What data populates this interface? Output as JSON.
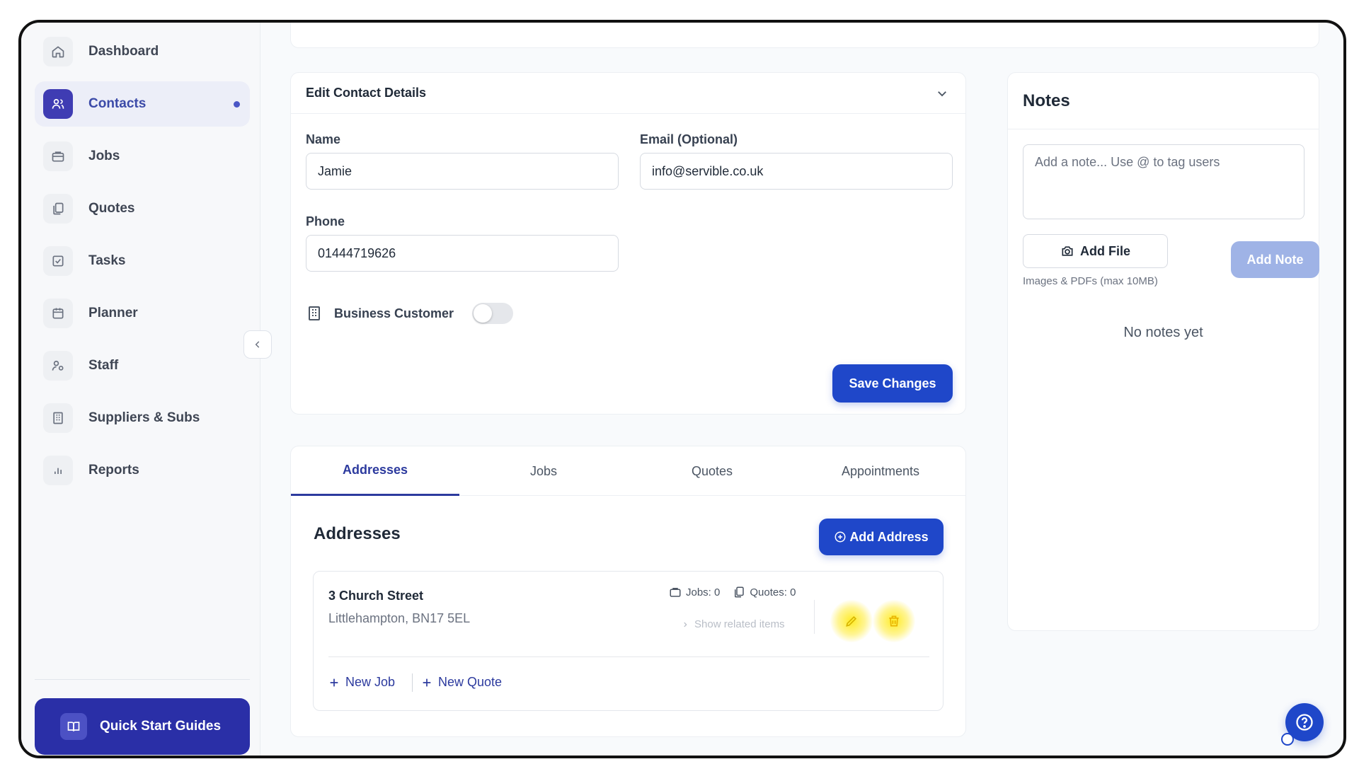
{
  "sidebar": {
    "items": [
      {
        "label": "Dashboard",
        "icon": "home-icon"
      },
      {
        "label": "Contacts",
        "icon": "users-icon",
        "active": true
      },
      {
        "label": "Jobs",
        "icon": "briefcase-icon"
      },
      {
        "label": "Quotes",
        "icon": "documents-icon"
      },
      {
        "label": "Tasks",
        "icon": "checkbox-icon"
      },
      {
        "label": "Planner",
        "icon": "calendar-icon"
      },
      {
        "label": "Staff",
        "icon": "staff-icon"
      },
      {
        "label": "Suppliers & Subs",
        "icon": "building-icon"
      },
      {
        "label": "Reports",
        "icon": "bar-chart-icon"
      }
    ],
    "quick_start_label": "Quick Start Guides"
  },
  "edit_contact": {
    "title": "Edit Contact Details",
    "name_label": "Name",
    "name_value": "Jamie",
    "email_label": "Email (Optional)",
    "email_value": "info@servible.co.uk",
    "phone_label": "Phone",
    "phone_value": "01444719626",
    "business_label": "Business Customer",
    "business_enabled": false,
    "save_label": "Save Changes"
  },
  "tabs": [
    "Addresses",
    "Jobs",
    "Quotes",
    "Appointments"
  ],
  "addresses": {
    "title": "Addresses",
    "add_label": "Add Address",
    "items": [
      {
        "street": "3 Church Street",
        "city": "Littlehampton, BN17 5EL",
        "jobs_count": "Jobs: 0",
        "quotes_count": "Quotes: 0",
        "related_label": "Show related items",
        "new_job_label": "New Job",
        "new_quote_label": "New Quote"
      }
    ]
  },
  "notes": {
    "title": "Notes",
    "placeholder": "Add a note... Use @ to tag users",
    "add_file_label": "Add File",
    "file_hint": "Images & PDFs (max 10MB)",
    "add_note_label": "Add Note",
    "empty_text": "No notes yet"
  },
  "colors": {
    "primary": "#1f47c9",
    "sidebar_active": "#3f3cb3",
    "highlight": "#ffe800"
  }
}
